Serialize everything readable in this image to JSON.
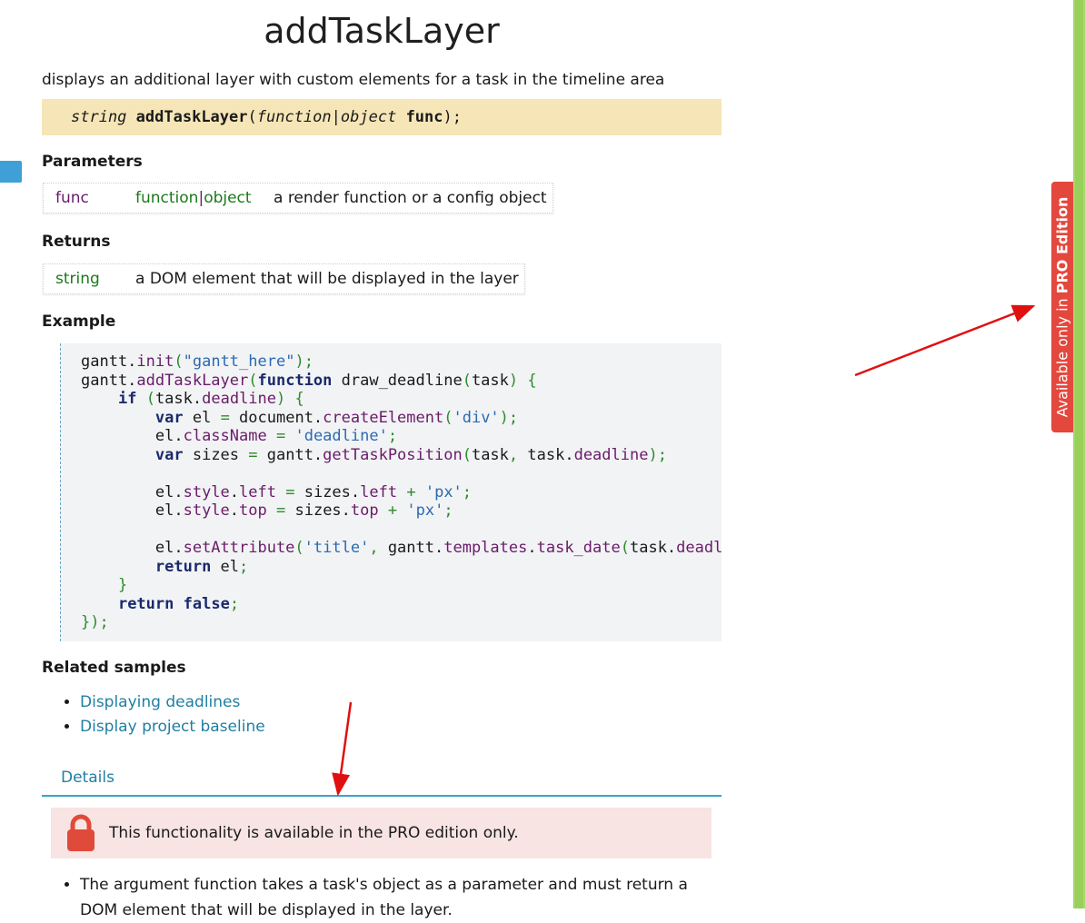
{
  "title": "addTaskLayer",
  "description": "displays an additional layer with custom elements for a task in the timeline area",
  "signature": {
    "ret": "string",
    "name": "addTaskLayer",
    "open": "(",
    "ptype1": "function",
    "sep": "|",
    "ptype2": "object",
    "pname": "func",
    "close": ");"
  },
  "parameters": {
    "heading": "Parameters",
    "name": "func",
    "type1": "function",
    "sep": "|",
    "type2": "object",
    "desc": "a render function or a config object"
  },
  "returns": {
    "heading": "Returns",
    "type": "string",
    "desc": "a DOM element that will be displayed in the layer"
  },
  "example": {
    "heading": "Example",
    "lines": [
      "gantt.init(\"gantt_here\");",
      "gantt.addTaskLayer(function draw_deadline(task) {",
      "    if (task.deadline) {",
      "        var el = document.createElement('div');",
      "        el.className = 'deadline';",
      "        var sizes = gantt.getTaskPosition(task, task.deadline);",
      "",
      "        el.style.left = sizes.left + 'px';",
      "        el.style.top = sizes.top + 'px';",
      "",
      "        el.setAttribute('title', gantt.templates.task_date(task.deadli",
      "        return el;",
      "    }",
      "    return false;",
      "});"
    ]
  },
  "related": {
    "heading": "Related samples",
    "items": [
      "Displaying deadlines",
      "Display project baseline"
    ]
  },
  "details": {
    "tab": "Details",
    "pro_notice": "This functionality is available in the PRO edition only.",
    "bullet": "The argument function takes a task's object as a parameter and must return a DOM element that will be displayed in the layer."
  },
  "pro_tab": {
    "prefix": "Available only in ",
    "bold": "PRO Edition"
  },
  "colors": {
    "accent": "#3aa3c9",
    "pro_red": "#e4473c",
    "sidebar_green": "#a6d86c",
    "signature_bg": "#f6e6b7"
  },
  "icons": [
    "lock-icon"
  ]
}
